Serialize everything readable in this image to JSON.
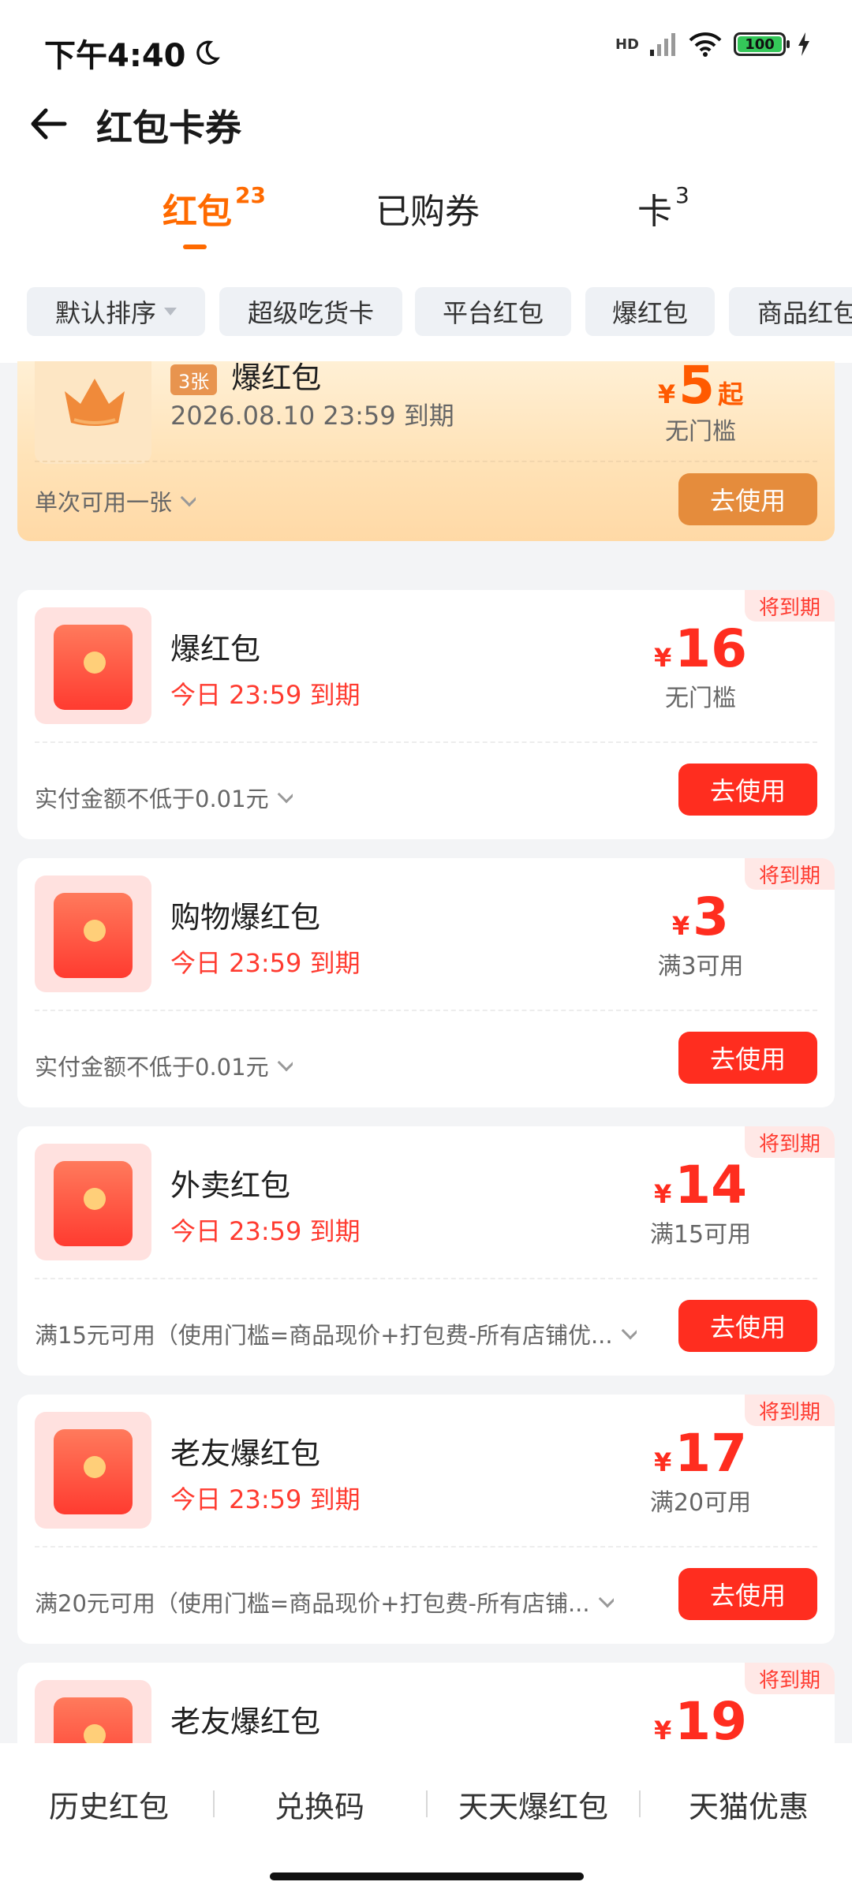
{
  "status_bar": {
    "time": "下午4:40",
    "network": "HD",
    "battery": "100"
  },
  "header": {
    "title": "红包卡券"
  },
  "tabs": [
    {
      "label": "红包",
      "count": "23"
    },
    {
      "label": "已购券",
      "count": ""
    },
    {
      "label": "卡",
      "count": "3"
    }
  ],
  "filters": [
    "默认排序",
    "超级吃货卡",
    "平台红包",
    "爆红包",
    "商品红包"
  ],
  "cards": [
    {
      "badge": "3张",
      "name": "爆红包",
      "expiry": "2026.08.10 23:59 到期",
      "currency": "¥",
      "amount": "5",
      "suffix": "起",
      "threshold": "无门槛",
      "note": "单次可用一张",
      "button": "去使用"
    },
    {
      "tag": "将到期",
      "name": "爆红包",
      "expiry": "今日 23:59 到期",
      "currency": "¥",
      "amount": "16",
      "threshold": "无门槛",
      "note": "实付金额不低于0.01元",
      "button": "去使用"
    },
    {
      "tag": "将到期",
      "name": "购物爆红包",
      "expiry": "今日 23:59 到期",
      "currency": "¥",
      "amount": "3",
      "threshold": "满3可用",
      "note": "实付金额不低于0.01元",
      "button": "去使用"
    },
    {
      "tag": "将到期",
      "name": "外卖红包",
      "expiry": "今日 23:59 到期",
      "currency": "¥",
      "amount": "14",
      "threshold": "满15可用",
      "note": "满15元可用（使用门槛=商品现价+打包费-所有店铺优...",
      "button": "去使用"
    },
    {
      "tag": "将到期",
      "name": "老友爆红包",
      "expiry": "今日 23:59 到期",
      "currency": "¥",
      "amount": "17",
      "threshold": "满20可用",
      "note": "满20元可用（使用门槛=商品现价+打包费-所有店铺...",
      "button": "去使用"
    },
    {
      "tag": "将到期",
      "name": "老友爆红包",
      "currency": "¥",
      "amount": "19"
    }
  ],
  "bottom_bar": [
    "历史红包",
    "兑换码",
    "天天爆红包",
    "天猫优惠"
  ]
}
